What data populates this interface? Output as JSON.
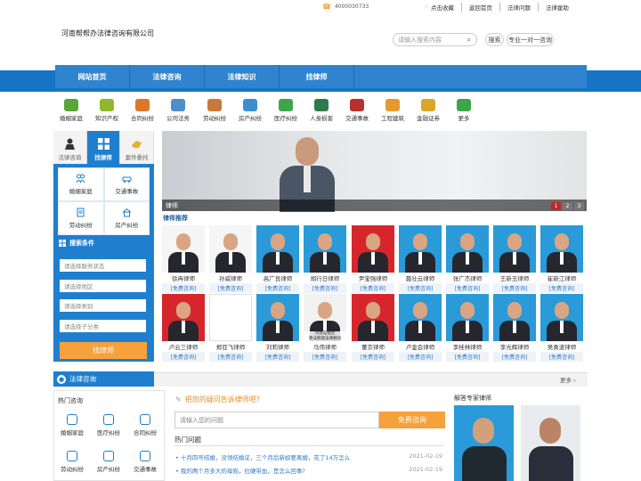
{
  "topbar": {
    "phone": "4000030733",
    "links": [
      "点击收藏",
      "返回首页",
      "法律问题",
      "法律援助"
    ]
  },
  "header": {
    "company": "河南帮帮办法律咨询有限公司",
    "search_placeholder": "请输入搜索内容",
    "search_btn": "搜索",
    "consult_btn": "专业一对一咨询"
  },
  "nav": [
    "网站首页",
    "法律咨询",
    "法律知识",
    "找律师"
  ],
  "categories": [
    {
      "label": "婚姻家庭",
      "color": "#5aa43a"
    },
    {
      "label": "知识产权",
      "color": "#8fb82d"
    },
    {
      "label": "合同纠纷",
      "color": "#d9772b"
    },
    {
      "label": "公司法务",
      "color": "#4d8fc9"
    },
    {
      "label": "劳动纠纷",
      "color": "#c77a3b"
    },
    {
      "label": "房产纠纷",
      "color": "#3b8fcf"
    },
    {
      "label": "医疗纠纷",
      "color": "#3ea64a"
    },
    {
      "label": "人身损害",
      "color": "#2f7a4a"
    },
    {
      "label": "交通事故",
      "color": "#b8312f"
    },
    {
      "label": "工程建筑",
      "color": "#e49a2f"
    },
    {
      "label": "金融证券",
      "color": "#d8a82a"
    },
    {
      "label": "更多",
      "color": "#3ea64a"
    }
  ],
  "leftpanel": {
    "tabs": [
      "法律咨询",
      "找律师",
      "案件委托"
    ],
    "grid": [
      "婚姻家庭",
      "交通事故",
      "劳动纠纷",
      "房产纠纷"
    ],
    "filter_title": "搜索条件",
    "selects": [
      "请选择服务状态",
      "请选择地区",
      "请选择类别",
      "请选择子分类"
    ],
    "find_btn": "找律师"
  },
  "banner": {
    "caption": "律师",
    "pages": [
      "1",
      "2",
      "3"
    ]
  },
  "recommend": {
    "title": "律师推荐",
    "free": "[免费咨询]",
    "row1": [
      "徐冉律师",
      "孙威律师",
      "高广良律师",
      "胡行日律师",
      "尹宝强律师",
      "聂壮云律师",
      "张广杰律师",
      "王新玉律师",
      "崔新江律师"
    ],
    "row2": [
      "卢云三律师",
      "郑亚飞律师",
      "刘莉律师",
      "马伟律师",
      "董京律师",
      "卢金会律师",
      "李桂林律师",
      "李光辉律师",
      "吴勇波律师"
    ],
    "photo_caption": "河南电视台\n政法频道法律顾问"
  },
  "consult": {
    "tab": "法律咨询",
    "more": "更多"
  },
  "hot": {
    "title": "热门咨询",
    "items": [
      "婚姻家庭",
      "医疗纠纷",
      "合同纠纷",
      "劳动纠纷",
      "房产纠纷",
      "交通事故"
    ]
  },
  "ask": {
    "title": "把您的疑问告诉律师吧?",
    "placeholder": "请输入您的问题",
    "btn": "免费咨询"
  },
  "hotq": {
    "title": "热门问题",
    "items": [
      {
        "text": "十月四号结婚，没领结婚证，三个月后新娘要离婚，花了14万怎么",
        "date": "2021-02-19"
      },
      {
        "text": "我的两个月多大的母狗，拉硬带血，是怎么回事?",
        "date": "2021-02-19"
      }
    ]
  },
  "expert": {
    "title": "解答专家律师"
  }
}
